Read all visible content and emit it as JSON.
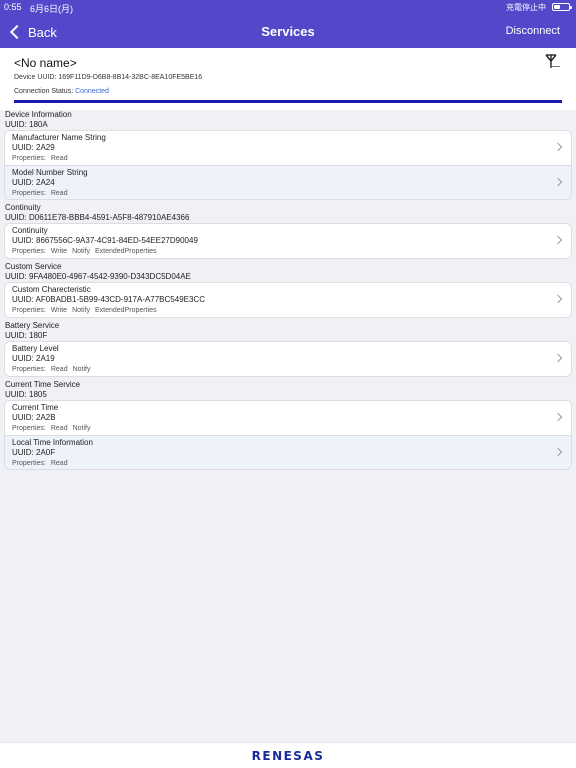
{
  "status_bar": {
    "time": "0:55",
    "date": "6月6日(月)",
    "charge_text": "充電停止中",
    "battery_level": 0.35
  },
  "nav": {
    "back_label": "Back",
    "title": "Services",
    "disconnect_label": "Disconnect"
  },
  "device": {
    "name": "<No name>",
    "uuid_text": "Device UUID: 169F11D9-D6B8-8B14-32BC-8EA10FE5BE16",
    "status_label": "Connection Status: ",
    "status_value": "Connected",
    "progress": 1.0,
    "antenna_icon": "antenna-icon"
  },
  "services": [
    {
      "name": "Device Information",
      "uuid": "UUID: 180A",
      "characteristics": [
        {
          "name": "Manufacturer Name String",
          "uuid": "UUID: 2A29",
          "props_label": "Properties:",
          "props": [
            "Read"
          ]
        },
        {
          "name": "Model Number String",
          "uuid": "UUID: 2A24",
          "props_label": "Properties:",
          "props": [
            "Read"
          ]
        }
      ]
    },
    {
      "name": "Continuity",
      "uuid": "UUID: D0611E78-BBB4-4591-A5F8-487910AE4366",
      "characteristics": [
        {
          "name": "Continuity",
          "uuid": "UUID: 8667556C-9A37-4C91-84ED-54EE27D90049",
          "props_label": "Properties:",
          "props": [
            "Write",
            "Notify",
            "ExtendedProperties"
          ]
        }
      ]
    },
    {
      "name": "Custom Service",
      "uuid": "UUID: 9FA480E0-4967-4542-9390-D343DC5D04AE",
      "characteristics": [
        {
          "name": "Custom Charecteristic",
          "uuid": "UUID: AF0BADB1-5B99-43CD-917A-A77BC549E3CC",
          "props_label": "Properties:",
          "props": [
            "Write",
            "Notify",
            "ExtendedProperties"
          ]
        }
      ]
    },
    {
      "name": "Battery Service",
      "uuid": "UUID: 180F",
      "characteristics": [
        {
          "name": "Battery Level",
          "uuid": "UUID: 2A19",
          "props_label": "Properties:",
          "props": [
            "Read",
            "Notify"
          ]
        }
      ]
    },
    {
      "name": "Current Time Service",
      "uuid": "UUID: 1805",
      "characteristics": [
        {
          "name": "Current Time",
          "uuid": "UUID: 2A2B",
          "props_label": "Properties:",
          "props": [
            "Read",
            "Notify"
          ]
        },
        {
          "name": "Local Time Information",
          "uuid": "UUID: 2A0F",
          "props_label": "Properties:",
          "props": [
            "Read"
          ]
        }
      ]
    }
  ],
  "footer": {
    "logo_text": "RENESAS"
  },
  "colors": {
    "nav_bar": "#5348c9",
    "progress": "#1a1aa8",
    "status_connected": "#3b6ad6",
    "row_alt": "#eef2fb",
    "logo": "#1a2a9a"
  }
}
